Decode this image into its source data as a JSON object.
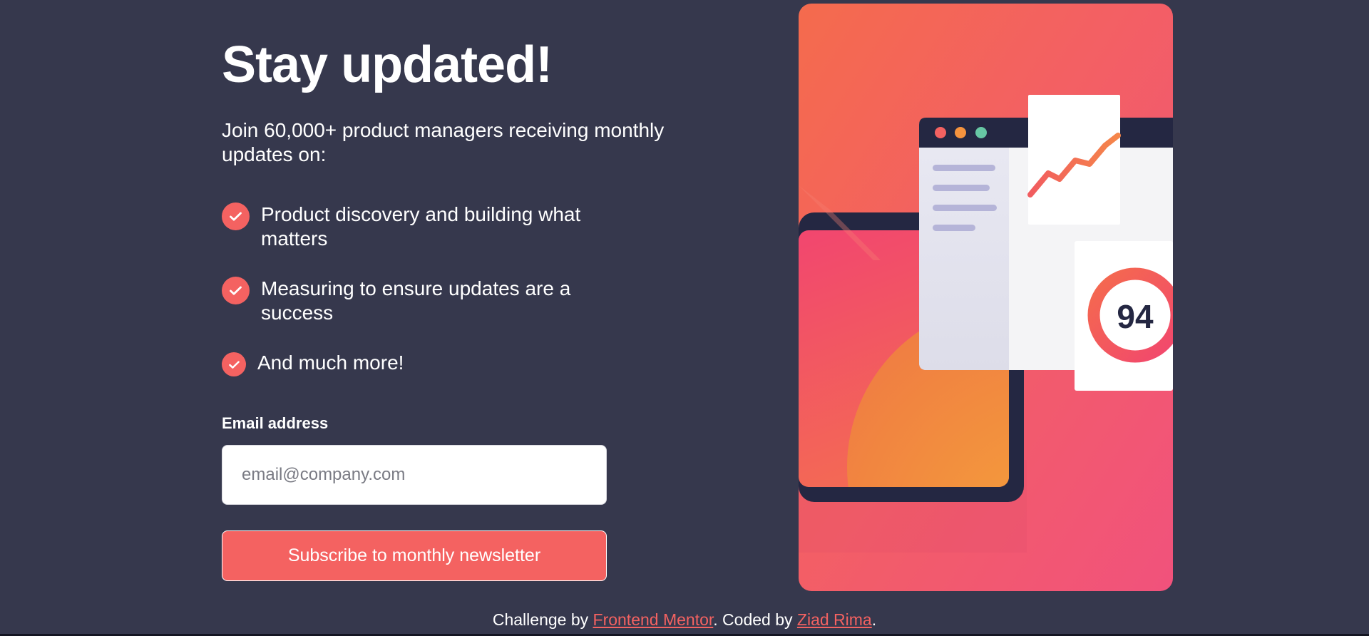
{
  "signup": {
    "title": "Stay updated!",
    "intro": "Join 60,000+ product managers receiving monthly updates on:",
    "features": [
      "Product discovery and building what matters",
      "Measuring to ensure updates are a success",
      "And much more!"
    ],
    "email_label": "Email address",
    "email_placeholder": "email@company.com",
    "submit_label": "Subscribe to monthly newsletter"
  },
  "illustration": {
    "score": "94"
  },
  "attribution": {
    "prefix": "Challenge by ",
    "challenge_link": "Frontend Mentor",
    "middle": ". Coded by ",
    "author_link": "Ziad Rima",
    "suffix": "."
  },
  "colors": {
    "background": "#36384d",
    "accent": "#f46261",
    "dark_navy": "#242742"
  }
}
